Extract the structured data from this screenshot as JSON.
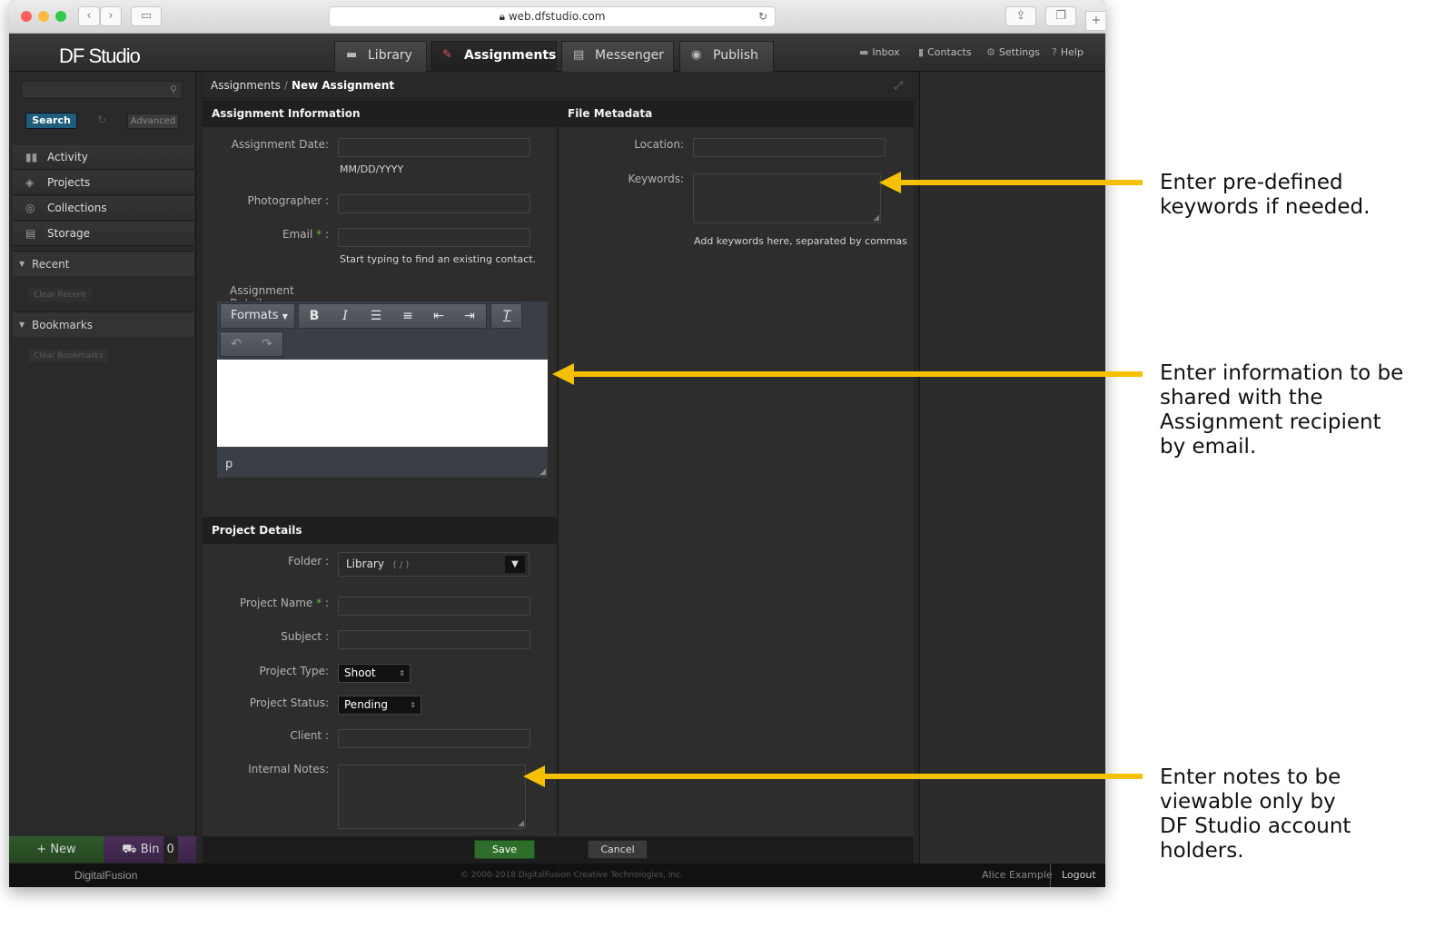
{
  "browser": {
    "url": "web.dfstudio.com"
  },
  "app": {
    "logo": "DF Studio",
    "tabs": [
      {
        "label": "Library",
        "icon": "library-icon"
      },
      {
        "label": "Assignments",
        "icon": "assignments-icon",
        "active": true
      },
      {
        "label": "Messenger",
        "icon": "messenger-icon"
      },
      {
        "label": "Publish",
        "icon": "publish-icon"
      }
    ],
    "utility": {
      "inbox": "Inbox",
      "contacts": "Contacts",
      "settings": "Settings",
      "help": "Help"
    }
  },
  "sidebar": {
    "search_button": "Search",
    "advanced_button": "Advanced",
    "items": [
      {
        "label": "Activity",
        "icon": "activity-icon"
      },
      {
        "label": "Projects",
        "icon": "projects-icon"
      },
      {
        "label": "Collections",
        "icon": "collections-icon"
      },
      {
        "label": "Storage",
        "icon": "storage-icon"
      }
    ],
    "recent": {
      "label": "Recent",
      "clear": "Clear Recent"
    },
    "bookmarks": {
      "label": "Bookmarks",
      "clear": "Clear Bookmarks"
    },
    "new_button": "New",
    "bin_button": "Bin",
    "bin_count": "0"
  },
  "breadcrumb": {
    "parent": "Assignments",
    "separator": "/",
    "current": "New Assignment"
  },
  "assignment_info": {
    "heading": "Assignment Information",
    "date_label": "Assignment Date:",
    "date_hint": "MM/DD/YYYY",
    "photographer_label": "Photographer :",
    "email_label": "Email",
    "email_colon": ":",
    "required_mark": "*",
    "email_hint": "Start typing to find an existing contact.",
    "details_label": "Assignment Details :",
    "formats_label": "Formats",
    "path_text": "p"
  },
  "file_metadata": {
    "heading": "File Metadata",
    "location_label": "Location:",
    "keywords_label": "Keywords:",
    "keywords_hint": "Add keywords here, separated by commas"
  },
  "project_details": {
    "heading": "Project Details",
    "folder_label": "Folder :",
    "folder_value": "Library",
    "folder_path": "( / )",
    "project_name_label": "Project Name",
    "subject_label": "Subject :",
    "project_type_label": "Project Type:",
    "project_type_value": "Shoot",
    "project_status_label": "Project Status:",
    "project_status_value": "Pending",
    "client_label": "Client :",
    "internal_notes_label": "Internal Notes:"
  },
  "actions": {
    "save": "Save",
    "cancel": "Cancel"
  },
  "footer": {
    "logo": "DigitalFusion",
    "copyright": "© 2000-2018 DigitalFusion Creative Technologies, Inc.",
    "user": "Alice Example",
    "logout": "Logout"
  },
  "annotations": [
    "Enter pre-defined\nkeywords if needed.",
    "Enter information to be\nshared with the\nAssignment recipient\nby email.",
    "Enter notes to be\nviewable only by\nDF Studio account\nholders."
  ],
  "colors": {
    "accent_arrow": "#f5c000",
    "save": "#2f6e2a",
    "search": "#1f5d7a",
    "required": "#6fbf3a"
  }
}
